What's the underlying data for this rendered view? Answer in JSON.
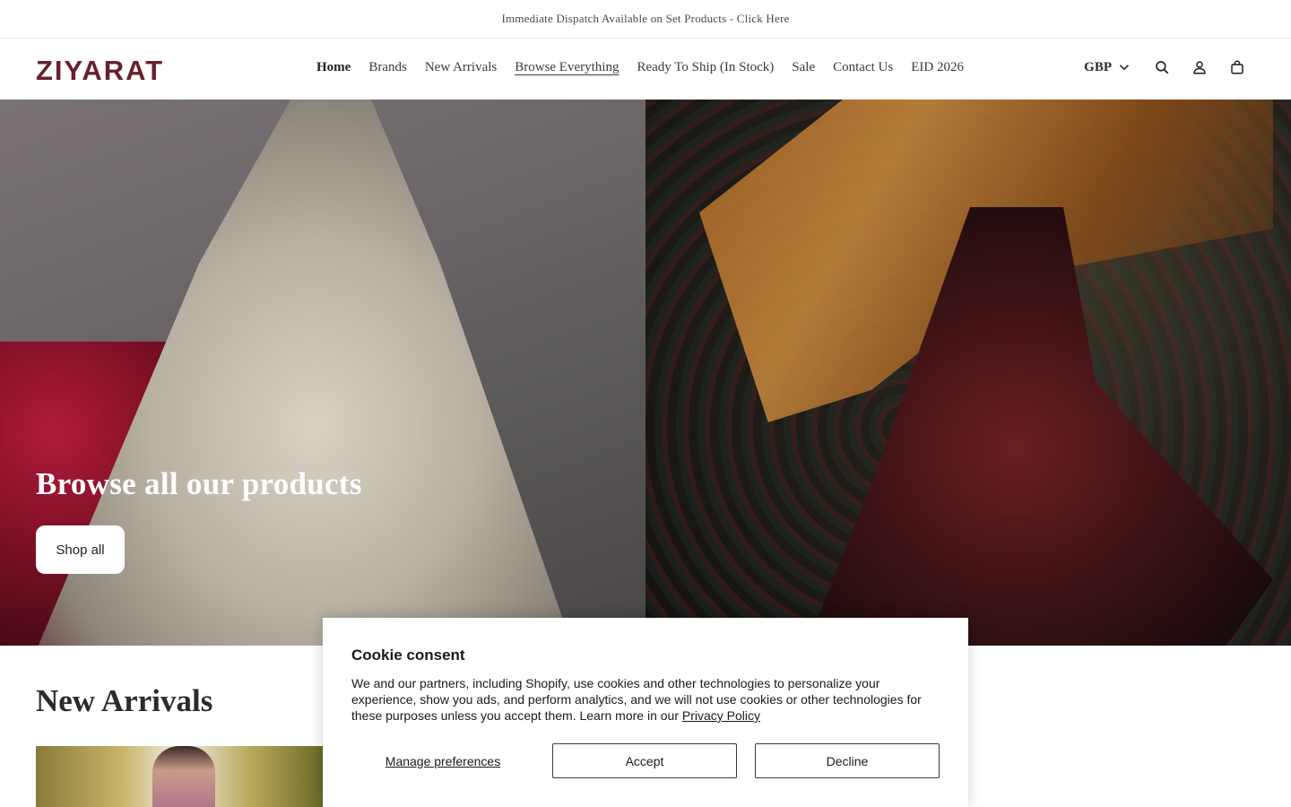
{
  "announcement": "Immediate Dispatch Available on Set Products - Click Here",
  "header": {
    "logo": "ZIYARAT",
    "nav": [
      "Home",
      "Brands",
      "New Arrivals",
      "Browse Everything",
      "Ready To Ship (In Stock)",
      "Sale",
      "Contact Us",
      "EID 2026"
    ],
    "currency": "GBP",
    "icons": [
      "search-icon",
      "account-icon",
      "cart-icon"
    ]
  },
  "hero": {
    "title": "Browse all our products",
    "button": "Shop all"
  },
  "new_arrivals": {
    "title": "New Arrivals"
  },
  "cookie": {
    "title": "Cookie consent",
    "body": "We and our partners, including Shopify, use cookies and other technologies to personalize your experience, show you ads, and perform analytics, and we will not use cookies or other technologies for these purposes unless you accept them. Learn more in our ",
    "link": "Privacy Policy",
    "manage": "Manage preferences",
    "accept": "Accept",
    "decline": "Decline"
  },
  "colors": {
    "brand": "#6a1f2b",
    "text": "#2b2b2b"
  }
}
